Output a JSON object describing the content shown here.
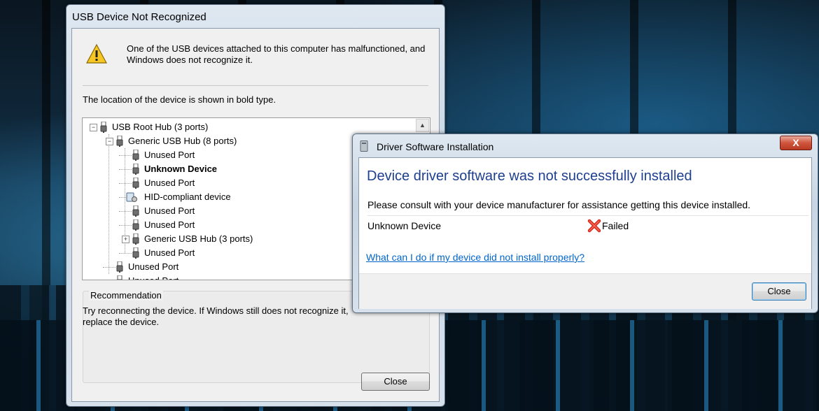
{
  "usb_dialog": {
    "title": "USB Device Not Recognized",
    "message": "One of the USB devices attached to this computer has malfunctioned, and Windows does not recognize it.",
    "location_note": "The location of the device is shown in bold type.",
    "tree": [
      {
        "label": "USB Root Hub (3 ports)",
        "expand": "−",
        "bold": false
      },
      {
        "label": "Generic USB Hub (8 ports)",
        "expand": "−",
        "bold": false
      },
      {
        "label": "Unused Port",
        "bold": false
      },
      {
        "label": "Unknown Device",
        "bold": true
      },
      {
        "label": "Unused Port",
        "bold": false
      },
      {
        "label": "HID-compliant device",
        "bold": false
      },
      {
        "label": "Unused Port",
        "bold": false
      },
      {
        "label": "Unused Port",
        "bold": false
      },
      {
        "label": "Generic USB Hub (3 ports)",
        "expand": "+",
        "bold": false
      },
      {
        "label": "Unused Port",
        "bold": false
      },
      {
        "label": "Unused Port",
        "bold": false
      },
      {
        "label": "Unused Port",
        "bold": false
      }
    ],
    "recommendation_title": "Recommendation",
    "recommendation_text": "Try reconnecting the device. If Windows still does not recognize it, replace the device.",
    "close_label": "Close"
  },
  "driver_dialog": {
    "title": "Driver Software Installation",
    "close_glyph": "X",
    "heading": "Device driver software was not successfully installed",
    "consult": "Please consult with your device manufacturer for assistance getting this device installed.",
    "device_name": "Unknown Device",
    "status": "Failed",
    "help_link": "What can I do if my device did not install properly?",
    "close_label": "Close"
  },
  "colors": {
    "heading_blue": "#1e3f8f",
    "link_blue": "#0066cc",
    "fail_red": "#d22b1c",
    "warning_yellow": "#f6c624"
  },
  "icons": {
    "warning": "warning-triangle-icon",
    "failed": "red-x-icon",
    "usb": "usb-plug-icon",
    "hid": "hid-device-icon"
  }
}
